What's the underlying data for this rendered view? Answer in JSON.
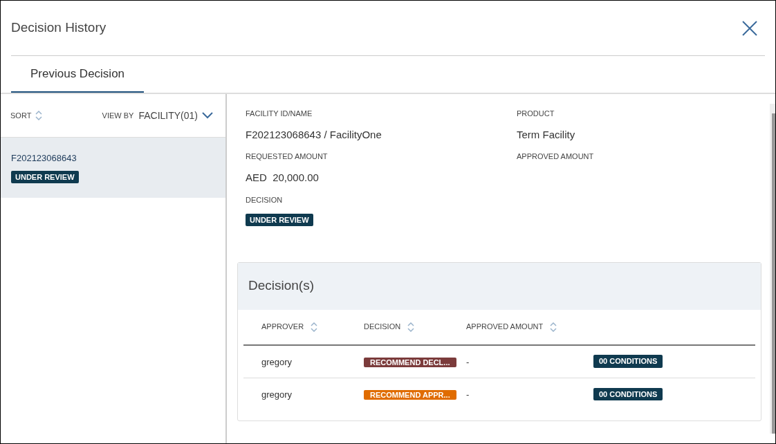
{
  "window": {
    "title": "Decision History"
  },
  "tabs": [
    {
      "label": "Previous Decision",
      "selected": true
    }
  ],
  "sidebar": {
    "sort_label": "SORT",
    "view_by_label": "VIEW BY",
    "view_by_value": "FACILITY(01)",
    "items": [
      {
        "id": "F202123068643",
        "status": "UNDER REVIEW",
        "selected": true
      }
    ]
  },
  "details": {
    "fields": [
      {
        "label": "FACILITY ID/NAME",
        "value": "F202123068643 / FacilityOne"
      },
      {
        "label": "PRODUCT",
        "value": "Term Facility"
      },
      {
        "label": "REQUESTED AMOUNT",
        "value": "AED  20,000.00"
      },
      {
        "label": "APPROVED AMOUNT"
      }
    ],
    "decision_label": "DECISION",
    "decision_status": "UNDER REVIEW"
  },
  "decisions": {
    "title": "Decision(s)",
    "columns": [
      "APPROVER",
      "DECISION",
      "APPROVED AMOUNT"
    ],
    "rows": [
      {
        "approver": "gregory",
        "decision": "RECOMMEND DECL...",
        "color": "#7b3b3b",
        "approved_amount": "-",
        "conditions": "00 CONDITIONS"
      },
      {
        "approver": "gregory",
        "decision": "RECOMMEND APPR...",
        "color": "#e06c00",
        "approved_amount": "-",
        "conditions": "00 CONDITIONS"
      }
    ]
  }
}
